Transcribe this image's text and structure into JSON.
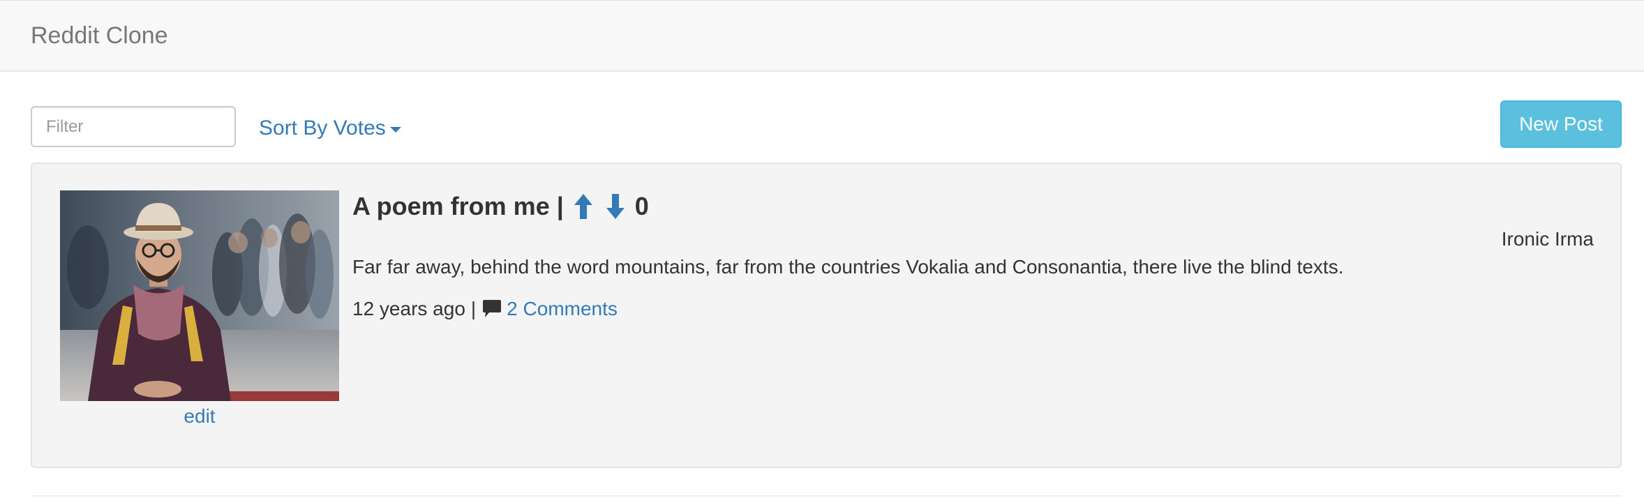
{
  "navbar": {
    "brand": "Reddit Clone"
  },
  "toolbar": {
    "filter_placeholder": "Filter",
    "filter_value": "",
    "sort_label": "Sort By Votes",
    "new_post_label": "New Post"
  },
  "posts": [
    {
      "title": "A poem from me",
      "separator": "|",
      "score": "0",
      "author": "Ironic Irma",
      "body": "Far far away, behind the word mountains, far from the countries Vokalia and Consonantia, there live the blind texts.",
      "age": "12 years ago",
      "meta_separator": "|",
      "comments_label": "2 Comments",
      "edit_label": "edit",
      "thumbnail_icon": "photo-of-man-with-hat-and-scarf"
    }
  ],
  "colors": {
    "link": "#337ab7",
    "info_button": "#5bc0de",
    "well_background": "#f4f4f4",
    "navbar_background": "#f8f8f8"
  }
}
